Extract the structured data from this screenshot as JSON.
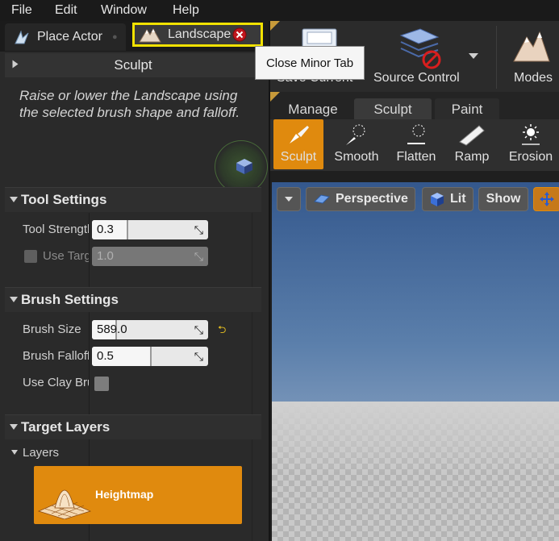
{
  "menu": [
    "File",
    "Edit",
    "Window",
    "Help"
  ],
  "tabs": {
    "place_actor": "Place Actor",
    "landscape": "Landscape"
  },
  "tooltip": "Close Minor Tab",
  "toolbar": {
    "save_current": "Save Current",
    "source_control": "Source Control",
    "modes": "Modes"
  },
  "mode_tabs": [
    "Manage",
    "Sculpt",
    "Paint"
  ],
  "tools": [
    "Sculpt",
    "Smooth",
    "Flatten",
    "Ramp",
    "Erosion"
  ],
  "panel": {
    "header": "Sculpt",
    "description": "Raise or lower the Landscape using the selected brush shape and falloff."
  },
  "tool_settings": {
    "title": "Tool Settings",
    "tool_strength_label": "Tool Strength",
    "tool_strength_value": "0.3",
    "tool_strength_fraction": 0.3,
    "use_target_label": "Use Target Value",
    "use_target_value": "1.0",
    "use_target_fraction": 1.0
  },
  "brush_settings": {
    "title": "Brush Settings",
    "brush_size_label": "Brush Size",
    "brush_size_value": "589.0",
    "brush_size_fraction": 0.2,
    "brush_falloff_label": "Brush Falloff",
    "brush_falloff_value": "0.5",
    "brush_falloff_fraction": 0.5,
    "use_clay_label": "Use Clay Brush"
  },
  "target_layers": {
    "title": "Target Layers",
    "layers_label": "Layers",
    "heightmap": "Heightmap"
  },
  "viewport": {
    "perspective": "Perspective",
    "lit": "Lit",
    "show": "Show"
  },
  "colors": {
    "accent_orange": "#e08a0e",
    "highlight_yellow": "#f2e200",
    "close_red": "#c0161d"
  }
}
